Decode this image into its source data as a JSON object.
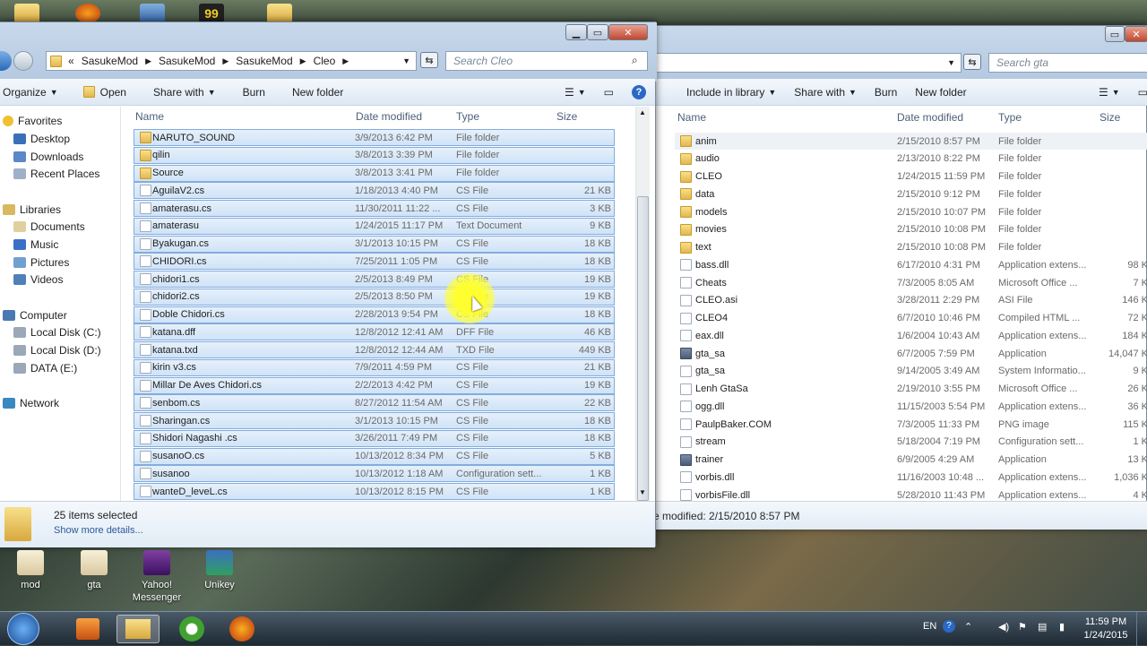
{
  "desktop": {
    "top_icons": [
      "folder-icon",
      "firefox-icon",
      "monitor-icon",
      "game-icon",
      "folder-icon"
    ],
    "top_badge": "99",
    "icons": [
      {
        "label": "mod",
        "icon": "folder-icon"
      },
      {
        "label": "gta",
        "icon": "folder-icon"
      },
      {
        "label": "Yahoo!\nMessenger",
        "icon": "yahoo-messenger-icon"
      },
      {
        "label": "Unikey",
        "icon": "unikey-icon"
      }
    ]
  },
  "left_window": {
    "breadcrumb": [
      "«",
      "SasukeMod",
      "SasukeMod",
      "SasukeMod",
      "Cleo"
    ],
    "search_placeholder": "Search Cleo",
    "toolbar": {
      "organize": "Organize",
      "open": "Open",
      "share_with": "Share with",
      "burn": "Burn",
      "new_folder": "New folder"
    },
    "nav": {
      "favorites": "Favorites",
      "desktop": "Desktop",
      "downloads": "Downloads",
      "recent": "Recent Places",
      "libraries": "Libraries",
      "documents": "Documents",
      "music": "Music",
      "pictures": "Pictures",
      "videos": "Videos",
      "computer": "Computer",
      "local_c": "Local Disk (C:)",
      "local_d": "Local Disk (D:)",
      "data_e": "DATA (E:)",
      "network": "Network"
    },
    "columns": {
      "name": "Name",
      "date": "Date modified",
      "type": "Type",
      "size": "Size"
    },
    "files": [
      {
        "name": "NARUTO_SOUND",
        "date": "3/9/2013 6:42 PM",
        "type": "File folder",
        "size": "",
        "kind": "folder"
      },
      {
        "name": "qilin",
        "date": "3/8/2013 3:39 PM",
        "type": "File folder",
        "size": "",
        "kind": "folder"
      },
      {
        "name": "Source",
        "date": "3/8/2013 3:41 PM",
        "type": "File folder",
        "size": "",
        "kind": "folder"
      },
      {
        "name": "AguilaV2.cs",
        "date": "1/18/2013 4:40 PM",
        "type": "CS File",
        "size": "21 KB",
        "kind": "doc"
      },
      {
        "name": "amaterasu.cs",
        "date": "11/30/2011 11:22 ...",
        "type": "CS File",
        "size": "3 KB",
        "kind": "doc"
      },
      {
        "name": "amaterasu",
        "date": "1/24/2015 11:17 PM",
        "type": "Text Document",
        "size": "9 KB",
        "kind": "doc"
      },
      {
        "name": "Byakugan.cs",
        "date": "3/1/2013 10:15 PM",
        "type": "CS File",
        "size": "18 KB",
        "kind": "doc"
      },
      {
        "name": "CHIDORI.cs",
        "date": "7/25/2011 1:05 PM",
        "type": "CS File",
        "size": "18 KB",
        "kind": "doc"
      },
      {
        "name": "chidori1.cs",
        "date": "2/5/2013 8:49 PM",
        "type": "CS File",
        "size": "19 KB",
        "kind": "doc"
      },
      {
        "name": "chidori2.cs",
        "date": "2/5/2013 8:50 PM",
        "type": "CS File",
        "size": "19 KB",
        "kind": "doc"
      },
      {
        "name": "Doble Chidori.cs",
        "date": "2/28/2013 9:54 PM",
        "type": "CS File",
        "size": "18 KB",
        "kind": "doc"
      },
      {
        "name": "katana.dff",
        "date": "12/8/2012 12:41 AM",
        "type": "DFF File",
        "size": "46 KB",
        "kind": "doc"
      },
      {
        "name": "katana.txd",
        "date": "12/8/2012 12:44 AM",
        "type": "TXD File",
        "size": "449 KB",
        "kind": "doc"
      },
      {
        "name": "kirin v3.cs",
        "date": "7/9/2011 4:59 PM",
        "type": "CS File",
        "size": "21 KB",
        "kind": "doc"
      },
      {
        "name": "Millar De Aves Chidori.cs",
        "date": "2/2/2013 4:42 PM",
        "type": "CS File",
        "size": "19 KB",
        "kind": "doc"
      },
      {
        "name": "senbom.cs",
        "date": "8/27/2012 11:54 AM",
        "type": "CS File",
        "size": "22 KB",
        "kind": "doc"
      },
      {
        "name": "Sharingan.cs",
        "date": "3/1/2013 10:15 PM",
        "type": "CS File",
        "size": "18 KB",
        "kind": "doc"
      },
      {
        "name": "Shidori Nagashi .cs",
        "date": "3/26/2011 7:49 PM",
        "type": "CS File",
        "size": "18 KB",
        "kind": "doc"
      },
      {
        "name": "susanoO.cs",
        "date": "10/13/2012 8:34 PM",
        "type": "CS File",
        "size": "5 KB",
        "kind": "doc"
      },
      {
        "name": "susanoo",
        "date": "10/13/2012 1:18 AM",
        "type": "Configuration sett...",
        "size": "1 KB",
        "kind": "doc"
      },
      {
        "name": "wanteD_leveL.cs",
        "date": "10/13/2012 8:15 PM",
        "type": "CS File",
        "size": "1 KB",
        "kind": "doc"
      }
    ],
    "details": {
      "count": "25 items selected",
      "more": "Show more details..."
    }
  },
  "right_window": {
    "search_placeholder": "Search gta",
    "toolbar": {
      "include": "Include in library",
      "share_with": "Share with",
      "burn": "Burn",
      "new_folder": "New folder"
    },
    "columns": {
      "name": "Name",
      "date": "Date modified",
      "type": "Type",
      "size": "Size"
    },
    "files": [
      {
        "name": "anim",
        "date": "2/15/2010 8:57 PM",
        "type": "File folder",
        "size": "",
        "kind": "folder"
      },
      {
        "name": "audio",
        "date": "2/13/2010 8:22 PM",
        "type": "File folder",
        "size": "",
        "kind": "folder"
      },
      {
        "name": "CLEO",
        "date": "1/24/2015 11:59 PM",
        "type": "File folder",
        "size": "",
        "kind": "folder"
      },
      {
        "name": "data",
        "date": "2/15/2010 9:12 PM",
        "type": "File folder",
        "size": "",
        "kind": "folder"
      },
      {
        "name": "models",
        "date": "2/15/2010 10:07 PM",
        "type": "File folder",
        "size": "",
        "kind": "folder"
      },
      {
        "name": "movies",
        "date": "2/15/2010 10:08 PM",
        "type": "File folder",
        "size": "",
        "kind": "folder"
      },
      {
        "name": "text",
        "date": "2/15/2010 10:08 PM",
        "type": "File folder",
        "size": "",
        "kind": "folder"
      },
      {
        "name": "bass.dll",
        "date": "6/17/2010 4:31 PM",
        "type": "Application extens...",
        "size": "98 K",
        "kind": "doc"
      },
      {
        "name": "Cheats",
        "date": "7/3/2005 8:05 AM",
        "type": "Microsoft Office ...",
        "size": "7 K",
        "kind": "doc"
      },
      {
        "name": "CLEO.asi",
        "date": "3/28/2011 2:29 PM",
        "type": "ASI File",
        "size": "146 K",
        "kind": "doc"
      },
      {
        "name": "CLEO4",
        "date": "6/7/2010 10:46 PM",
        "type": "Compiled HTML ...",
        "size": "72 K",
        "kind": "doc"
      },
      {
        "name": "eax.dll",
        "date": "1/6/2004 10:43 AM",
        "type": "Application extens...",
        "size": "184 K",
        "kind": "doc"
      },
      {
        "name": "gta_sa",
        "date": "6/7/2005 7:59 PM",
        "type": "Application",
        "size": "14,047 K",
        "kind": "app"
      },
      {
        "name": "gta_sa",
        "date": "9/14/2005 3:49 AM",
        "type": "System Informatio...",
        "size": "9 K",
        "kind": "doc"
      },
      {
        "name": "Lenh GtaSa",
        "date": "2/19/2010 3:55 PM",
        "type": "Microsoft Office ...",
        "size": "26 K",
        "kind": "doc"
      },
      {
        "name": "ogg.dll",
        "date": "11/15/2003 5:54 PM",
        "type": "Application extens...",
        "size": "36 K",
        "kind": "doc"
      },
      {
        "name": "PaulpBaker.COM",
        "date": "7/3/2005 11:33 PM",
        "type": "PNG image",
        "size": "115 K",
        "kind": "doc"
      },
      {
        "name": "stream",
        "date": "5/18/2004 7:19 PM",
        "type": "Configuration sett...",
        "size": "1 K",
        "kind": "doc"
      },
      {
        "name": "trainer",
        "date": "6/9/2005 4:29 AM",
        "type": "Application",
        "size": "13 K",
        "kind": "app"
      },
      {
        "name": "vorbis.dll",
        "date": "11/16/2003 10:48 ...",
        "type": "Application extens...",
        "size": "1,036 K",
        "kind": "doc"
      },
      {
        "name": "vorbisFile.dll",
        "date": "5/28/2010 11:43 PM",
        "type": "Application extens...",
        "size": "4 K",
        "kind": "doc"
      }
    ],
    "details": "e modified: 2/15/2010 8:57 PM"
  },
  "taskbar": {
    "lang": "EN",
    "time": "11:59 PM",
    "date": "1/24/2015"
  },
  "colors": {
    "selection": "#cfe3f8",
    "selection_border": "#84acdd",
    "taskbar": "#1e2a34"
  }
}
